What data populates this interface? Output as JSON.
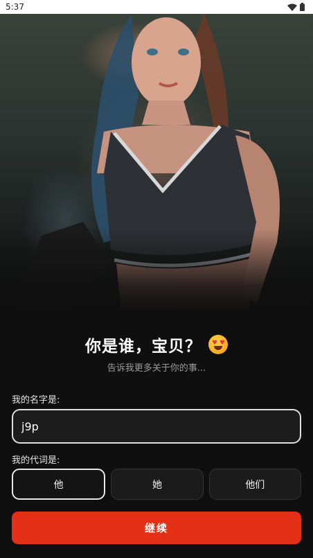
{
  "status_bar": {
    "time": "5:37",
    "icons": [
      "wifi-icon",
      "battery-icon"
    ]
  },
  "hero": {
    "image": "portrait-photo"
  },
  "intro": {
    "title": "你是谁，宝贝？",
    "title_emoji": "heart-eyes-emoji",
    "subtitle": "告诉我更多关于你的事..."
  },
  "form": {
    "name_label": "我的名字是:",
    "name_value": "j9p",
    "pronoun_label": "我的代词是:",
    "pronouns": [
      {
        "label": "他",
        "selected": true
      },
      {
        "label": "她",
        "selected": false
      },
      {
        "label": "他们",
        "selected": false
      }
    ],
    "continue_label": "继续"
  },
  "colors": {
    "background": "#0f0f0f",
    "accent": "#e53018",
    "field_border": "#e0e0e0"
  }
}
